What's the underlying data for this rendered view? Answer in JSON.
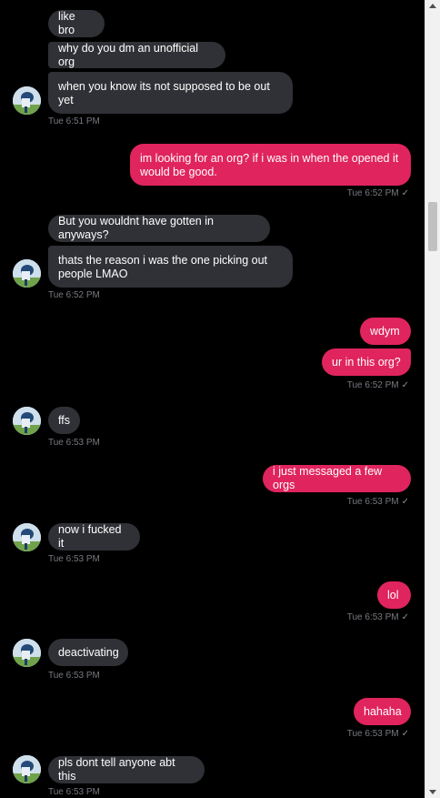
{
  "messages": [
    {
      "id": "m1",
      "dir": "in",
      "text": "like bro"
    },
    {
      "id": "m2",
      "dir": "in",
      "text": "why do you dm an unofficial org"
    },
    {
      "id": "m3",
      "dir": "in",
      "text": "when you know its not supposed to be out yet"
    },
    {
      "id": "t1",
      "text": "Tue 6:51 PM"
    },
    {
      "id": "m4",
      "dir": "out",
      "text": "im looking for an org? if i was in when the opened it would be good."
    },
    {
      "id": "t2",
      "text": "Tue 6:52 PM",
      "check": "✓"
    },
    {
      "id": "m5",
      "dir": "in",
      "text": "But you wouldnt have gotten in anyways?"
    },
    {
      "id": "m6",
      "dir": "in",
      "text": "thats the reason i was the one picking out people LMAO"
    },
    {
      "id": "t3",
      "text": "Tue 6:52 PM"
    },
    {
      "id": "m7",
      "dir": "out",
      "text": "wdym"
    },
    {
      "id": "m8",
      "dir": "out",
      "text": "ur in this org?"
    },
    {
      "id": "t4",
      "text": "Tue 6:52 PM",
      "check": "✓"
    },
    {
      "id": "m9",
      "dir": "in",
      "text": "ffs"
    },
    {
      "id": "t5",
      "text": "Tue 6:53 PM"
    },
    {
      "id": "m10",
      "dir": "out",
      "text": "i just messaged a few orgs"
    },
    {
      "id": "t6",
      "text": "Tue 6:53 PM",
      "check": "✓"
    },
    {
      "id": "m11",
      "dir": "in",
      "text": "now i fucked it"
    },
    {
      "id": "t7",
      "text": "Tue 6:53 PM"
    },
    {
      "id": "m12",
      "dir": "out",
      "text": "lol"
    },
    {
      "id": "t8",
      "text": "Tue 6:53 PM",
      "check": "✓"
    },
    {
      "id": "m13",
      "dir": "in",
      "text": "deactivating"
    },
    {
      "id": "t9",
      "text": "Tue 6:53 PM"
    },
    {
      "id": "m14",
      "dir": "out",
      "text": "hahaha"
    },
    {
      "id": "t10",
      "text": "Tue 6:53 PM",
      "check": "✓"
    },
    {
      "id": "m15",
      "dir": "in",
      "text": "pls dont tell anyone abt this"
    },
    {
      "id": "t11",
      "text": "Tue 6:53 PM"
    }
  ],
  "avatar_icon": "user-avatar-icon",
  "colors": {
    "incoming": "#2f3136",
    "outgoing": "#e0245e",
    "background": "#000000",
    "timestamp": "#777a80"
  }
}
